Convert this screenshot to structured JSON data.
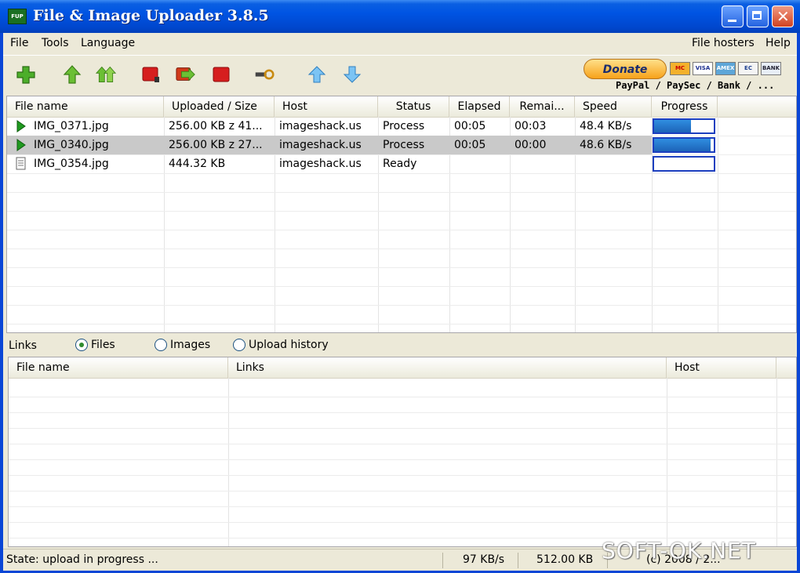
{
  "window": {
    "title": "File & Image Uploader 3.8.5",
    "app_icon": "FUP"
  },
  "menu": {
    "left": [
      "File",
      "Tools",
      "Language"
    ],
    "right": [
      "File hosters",
      "Help"
    ]
  },
  "toolbar": {
    "donate_label": "Donate",
    "payment_caption": "PayPal / PaySec / Bank / ...",
    "payment_icons": [
      "MC",
      "VISA",
      "AMEX",
      "EC",
      "BANK"
    ]
  },
  "upload_table": {
    "columns": [
      "File name",
      "Uploaded / Size",
      "Host",
      "Status",
      "Elapsed",
      "Remai...",
      "Speed",
      "Progress"
    ],
    "rows": [
      {
        "file": "IMG_0371.jpg",
        "uploaded": "256.00 KB z 41...",
        "host": "imageshack.us",
        "status": "Process",
        "elapsed": "00:05",
        "remaining": "00:03",
        "speed": "48.4 KB/s",
        "progress": 0.62,
        "icon": "play-icon"
      },
      {
        "file": "IMG_0340.jpg",
        "uploaded": "256.00 KB z 27...",
        "host": "imageshack.us",
        "status": "Process",
        "elapsed": "00:05",
        "remaining": "00:00",
        "speed": "48.6 KB/s",
        "progress": 0.95,
        "icon": "play-icon"
      },
      {
        "file": "IMG_0354.jpg",
        "uploaded": "444.32 KB",
        "host": "imageshack.us",
        "status": "Ready",
        "elapsed": "",
        "remaining": "",
        "speed": "",
        "progress": 0.0,
        "icon": "file-icon"
      }
    ]
  },
  "links": {
    "label": "Links",
    "options": [
      "Files",
      "Images",
      "Upload history"
    ],
    "selected": "Files"
  },
  "links_table": {
    "columns": [
      "File name",
      "Links",
      "Host"
    ]
  },
  "status": {
    "state": "State: upload in progress ...",
    "speed": "97 KB/s",
    "size": "512.00 KB",
    "copyright": "(c) 2008 / 2..."
  },
  "watermark": "SOFT-OK.NET",
  "colors": {
    "title_blue": "#0054e3",
    "window_bg": "#ece9d8",
    "progress": "#1d63b8",
    "selected_row": "#c9c9c9"
  }
}
